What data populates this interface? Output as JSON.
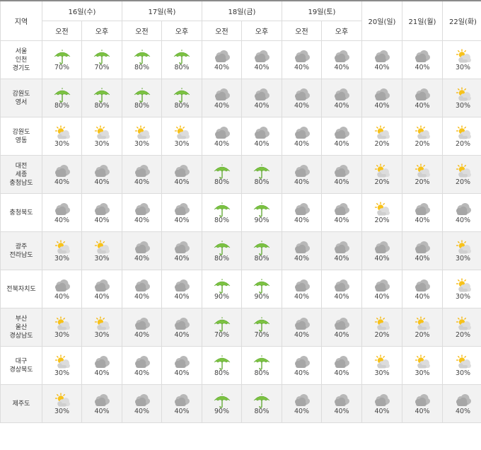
{
  "header": {
    "region_label": "지역",
    "days": [
      {
        "label": "16일(수)",
        "split": true
      },
      {
        "label": "17일(목)",
        "split": true
      },
      {
        "label": "18일(금)",
        "split": true
      },
      {
        "label": "19일(토)",
        "split": true
      },
      {
        "label": "20일(일)",
        "split": false
      },
      {
        "label": "21일(월)",
        "split": false
      },
      {
        "label": "22일(화)",
        "split": false
      }
    ],
    "am_label": "오전",
    "pm_label": "오후"
  },
  "icons": {
    "rain": "umbrella-icon",
    "cloud": "cloudy-icon",
    "sun": "partly-sunny-icon"
  },
  "colors": {
    "umbrella": "#7cc242",
    "cloud": "#b3b3b3",
    "sun": "#f5b400",
    "row_shade": "#f2f2f2"
  },
  "rows": [
    {
      "region": [
        "서울",
        "인천",
        "경기도"
      ],
      "shade": false,
      "cells": [
        {
          "icon": "rain",
          "pct": "70%"
        },
        {
          "icon": "rain",
          "pct": "70%"
        },
        {
          "icon": "rain",
          "pct": "80%"
        },
        {
          "icon": "rain",
          "pct": "80%"
        },
        {
          "icon": "cloud",
          "pct": "40%"
        },
        {
          "icon": "cloud",
          "pct": "40%"
        },
        {
          "icon": "cloud",
          "pct": "40%"
        },
        {
          "icon": "cloud",
          "pct": "40%"
        },
        {
          "icon": "cloud",
          "pct": "40%"
        },
        {
          "icon": "cloud",
          "pct": "40%"
        },
        {
          "icon": "sun",
          "pct": "30%"
        }
      ]
    },
    {
      "region": [
        "강원도",
        "영서"
      ],
      "shade": true,
      "cells": [
        {
          "icon": "rain",
          "pct": "80%"
        },
        {
          "icon": "rain",
          "pct": "80%"
        },
        {
          "icon": "rain",
          "pct": "80%"
        },
        {
          "icon": "rain",
          "pct": "80%"
        },
        {
          "icon": "cloud",
          "pct": "40%"
        },
        {
          "icon": "cloud",
          "pct": "40%"
        },
        {
          "icon": "cloud",
          "pct": "40%"
        },
        {
          "icon": "cloud",
          "pct": "40%"
        },
        {
          "icon": "cloud",
          "pct": "40%"
        },
        {
          "icon": "cloud",
          "pct": "40%"
        },
        {
          "icon": "sun",
          "pct": "30%"
        }
      ]
    },
    {
      "region": [
        "강원도",
        "영동"
      ],
      "shade": false,
      "cells": [
        {
          "icon": "sun",
          "pct": "30%"
        },
        {
          "icon": "sun",
          "pct": "30%"
        },
        {
          "icon": "sun",
          "pct": "30%"
        },
        {
          "icon": "sun",
          "pct": "30%"
        },
        {
          "icon": "cloud",
          "pct": "40%"
        },
        {
          "icon": "cloud",
          "pct": "40%"
        },
        {
          "icon": "cloud",
          "pct": "40%"
        },
        {
          "icon": "cloud",
          "pct": "40%"
        },
        {
          "icon": "sun",
          "pct": "20%"
        },
        {
          "icon": "sun",
          "pct": "20%"
        },
        {
          "icon": "sun",
          "pct": "20%"
        }
      ]
    },
    {
      "region": [
        "대전",
        "세종",
        "충청남도"
      ],
      "shade": true,
      "cells": [
        {
          "icon": "cloud",
          "pct": "40%"
        },
        {
          "icon": "cloud",
          "pct": "40%"
        },
        {
          "icon": "cloud",
          "pct": "40%"
        },
        {
          "icon": "cloud",
          "pct": "40%"
        },
        {
          "icon": "rain",
          "pct": "80%"
        },
        {
          "icon": "rain",
          "pct": "80%"
        },
        {
          "icon": "cloud",
          "pct": "40%"
        },
        {
          "icon": "cloud",
          "pct": "40%"
        },
        {
          "icon": "sun",
          "pct": "20%"
        },
        {
          "icon": "sun",
          "pct": "20%"
        },
        {
          "icon": "sun",
          "pct": "20%"
        }
      ]
    },
    {
      "region": [
        "충청북도"
      ],
      "shade": false,
      "cells": [
        {
          "icon": "cloud",
          "pct": "40%"
        },
        {
          "icon": "cloud",
          "pct": "40%"
        },
        {
          "icon": "cloud",
          "pct": "40%"
        },
        {
          "icon": "cloud",
          "pct": "40%"
        },
        {
          "icon": "rain",
          "pct": "80%"
        },
        {
          "icon": "rain",
          "pct": "90%"
        },
        {
          "icon": "cloud",
          "pct": "40%"
        },
        {
          "icon": "cloud",
          "pct": "40%"
        },
        {
          "icon": "sun",
          "pct": "20%"
        },
        {
          "icon": "cloud",
          "pct": "40%"
        },
        {
          "icon": "cloud",
          "pct": "40%"
        }
      ]
    },
    {
      "region": [
        "광주",
        "전라남도"
      ],
      "shade": true,
      "cells": [
        {
          "icon": "sun",
          "pct": "30%"
        },
        {
          "icon": "sun",
          "pct": "30%"
        },
        {
          "icon": "cloud",
          "pct": "40%"
        },
        {
          "icon": "cloud",
          "pct": "40%"
        },
        {
          "icon": "rain",
          "pct": "80%"
        },
        {
          "icon": "rain",
          "pct": "80%"
        },
        {
          "icon": "cloud",
          "pct": "40%"
        },
        {
          "icon": "cloud",
          "pct": "40%"
        },
        {
          "icon": "cloud",
          "pct": "40%"
        },
        {
          "icon": "cloud",
          "pct": "40%"
        },
        {
          "icon": "sun",
          "pct": "30%"
        }
      ]
    },
    {
      "region": [
        "전북자치도"
      ],
      "shade": false,
      "cells": [
        {
          "icon": "cloud",
          "pct": "40%"
        },
        {
          "icon": "cloud",
          "pct": "40%"
        },
        {
          "icon": "cloud",
          "pct": "40%"
        },
        {
          "icon": "cloud",
          "pct": "40%"
        },
        {
          "icon": "rain",
          "pct": "90%"
        },
        {
          "icon": "rain",
          "pct": "90%"
        },
        {
          "icon": "cloud",
          "pct": "40%"
        },
        {
          "icon": "cloud",
          "pct": "40%"
        },
        {
          "icon": "cloud",
          "pct": "40%"
        },
        {
          "icon": "cloud",
          "pct": "40%"
        },
        {
          "icon": "sun",
          "pct": "30%"
        }
      ]
    },
    {
      "region": [
        "부산",
        "울산",
        "경상남도"
      ],
      "shade": true,
      "cells": [
        {
          "icon": "sun",
          "pct": "30%"
        },
        {
          "icon": "sun",
          "pct": "30%"
        },
        {
          "icon": "cloud",
          "pct": "40%"
        },
        {
          "icon": "cloud",
          "pct": "40%"
        },
        {
          "icon": "rain",
          "pct": "70%"
        },
        {
          "icon": "rain",
          "pct": "70%"
        },
        {
          "icon": "cloud",
          "pct": "40%"
        },
        {
          "icon": "cloud",
          "pct": "40%"
        },
        {
          "icon": "sun",
          "pct": "20%"
        },
        {
          "icon": "sun",
          "pct": "20%"
        },
        {
          "icon": "sun",
          "pct": "20%"
        }
      ]
    },
    {
      "region": [
        "대구",
        "경상북도"
      ],
      "shade": false,
      "cells": [
        {
          "icon": "sun",
          "pct": "30%"
        },
        {
          "icon": "cloud",
          "pct": "40%"
        },
        {
          "icon": "cloud",
          "pct": "40%"
        },
        {
          "icon": "cloud",
          "pct": "40%"
        },
        {
          "icon": "rain",
          "pct": "80%"
        },
        {
          "icon": "rain",
          "pct": "80%"
        },
        {
          "icon": "cloud",
          "pct": "40%"
        },
        {
          "icon": "cloud",
          "pct": "40%"
        },
        {
          "icon": "sun",
          "pct": "30%"
        },
        {
          "icon": "sun",
          "pct": "30%"
        },
        {
          "icon": "sun",
          "pct": "30%"
        }
      ]
    },
    {
      "region": [
        "제주도"
      ],
      "shade": true,
      "cells": [
        {
          "icon": "sun",
          "pct": "30%"
        },
        {
          "icon": "cloud",
          "pct": "40%"
        },
        {
          "icon": "cloud",
          "pct": "40%"
        },
        {
          "icon": "cloud",
          "pct": "40%"
        },
        {
          "icon": "rain",
          "pct": "90%"
        },
        {
          "icon": "rain",
          "pct": "80%"
        },
        {
          "icon": "cloud",
          "pct": "40%"
        },
        {
          "icon": "cloud",
          "pct": "40%"
        },
        {
          "icon": "cloud",
          "pct": "40%"
        },
        {
          "icon": "cloud",
          "pct": "40%"
        },
        {
          "icon": "cloud",
          "pct": "40%"
        }
      ]
    }
  ]
}
